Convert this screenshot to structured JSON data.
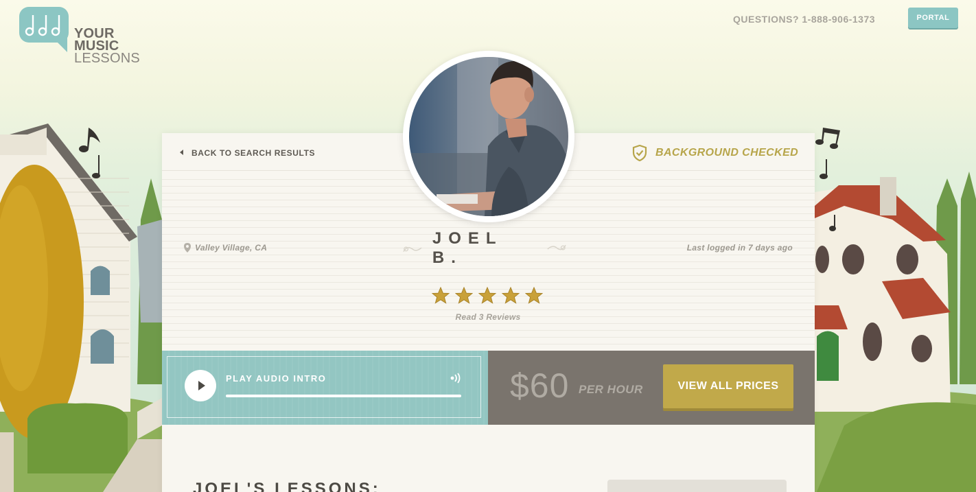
{
  "header": {
    "logo_line1": "YOUR",
    "logo_line2": "MUSIC",
    "logo_line3": "LESSONS",
    "questions": "QUESTIONS? 1-888-906-1373",
    "portal_label": "PORTAL"
  },
  "profile": {
    "back_label": "BACK TO SEARCH RESULTS",
    "background_checked": "BACKGROUND CHECKED",
    "location": "Valley Village, CA",
    "name": "JOEL B.",
    "last_logged": "Last logged in 7 days ago",
    "rating_stars": 5,
    "reviews_link": "Read 3 Reviews"
  },
  "audio": {
    "label": "PLAY AUDIO INTRO"
  },
  "pricing": {
    "price": "$60",
    "unit": "PER HOUR",
    "view_prices_label": "VIEW ALL PRICES"
  },
  "lessons": {
    "title": "JOEL'S LESSONS:"
  },
  "colors": {
    "teal": "#8cc6c3",
    "gold": "#c1a94a",
    "taupe": "#7a746d",
    "text_dark": "#55514b"
  }
}
